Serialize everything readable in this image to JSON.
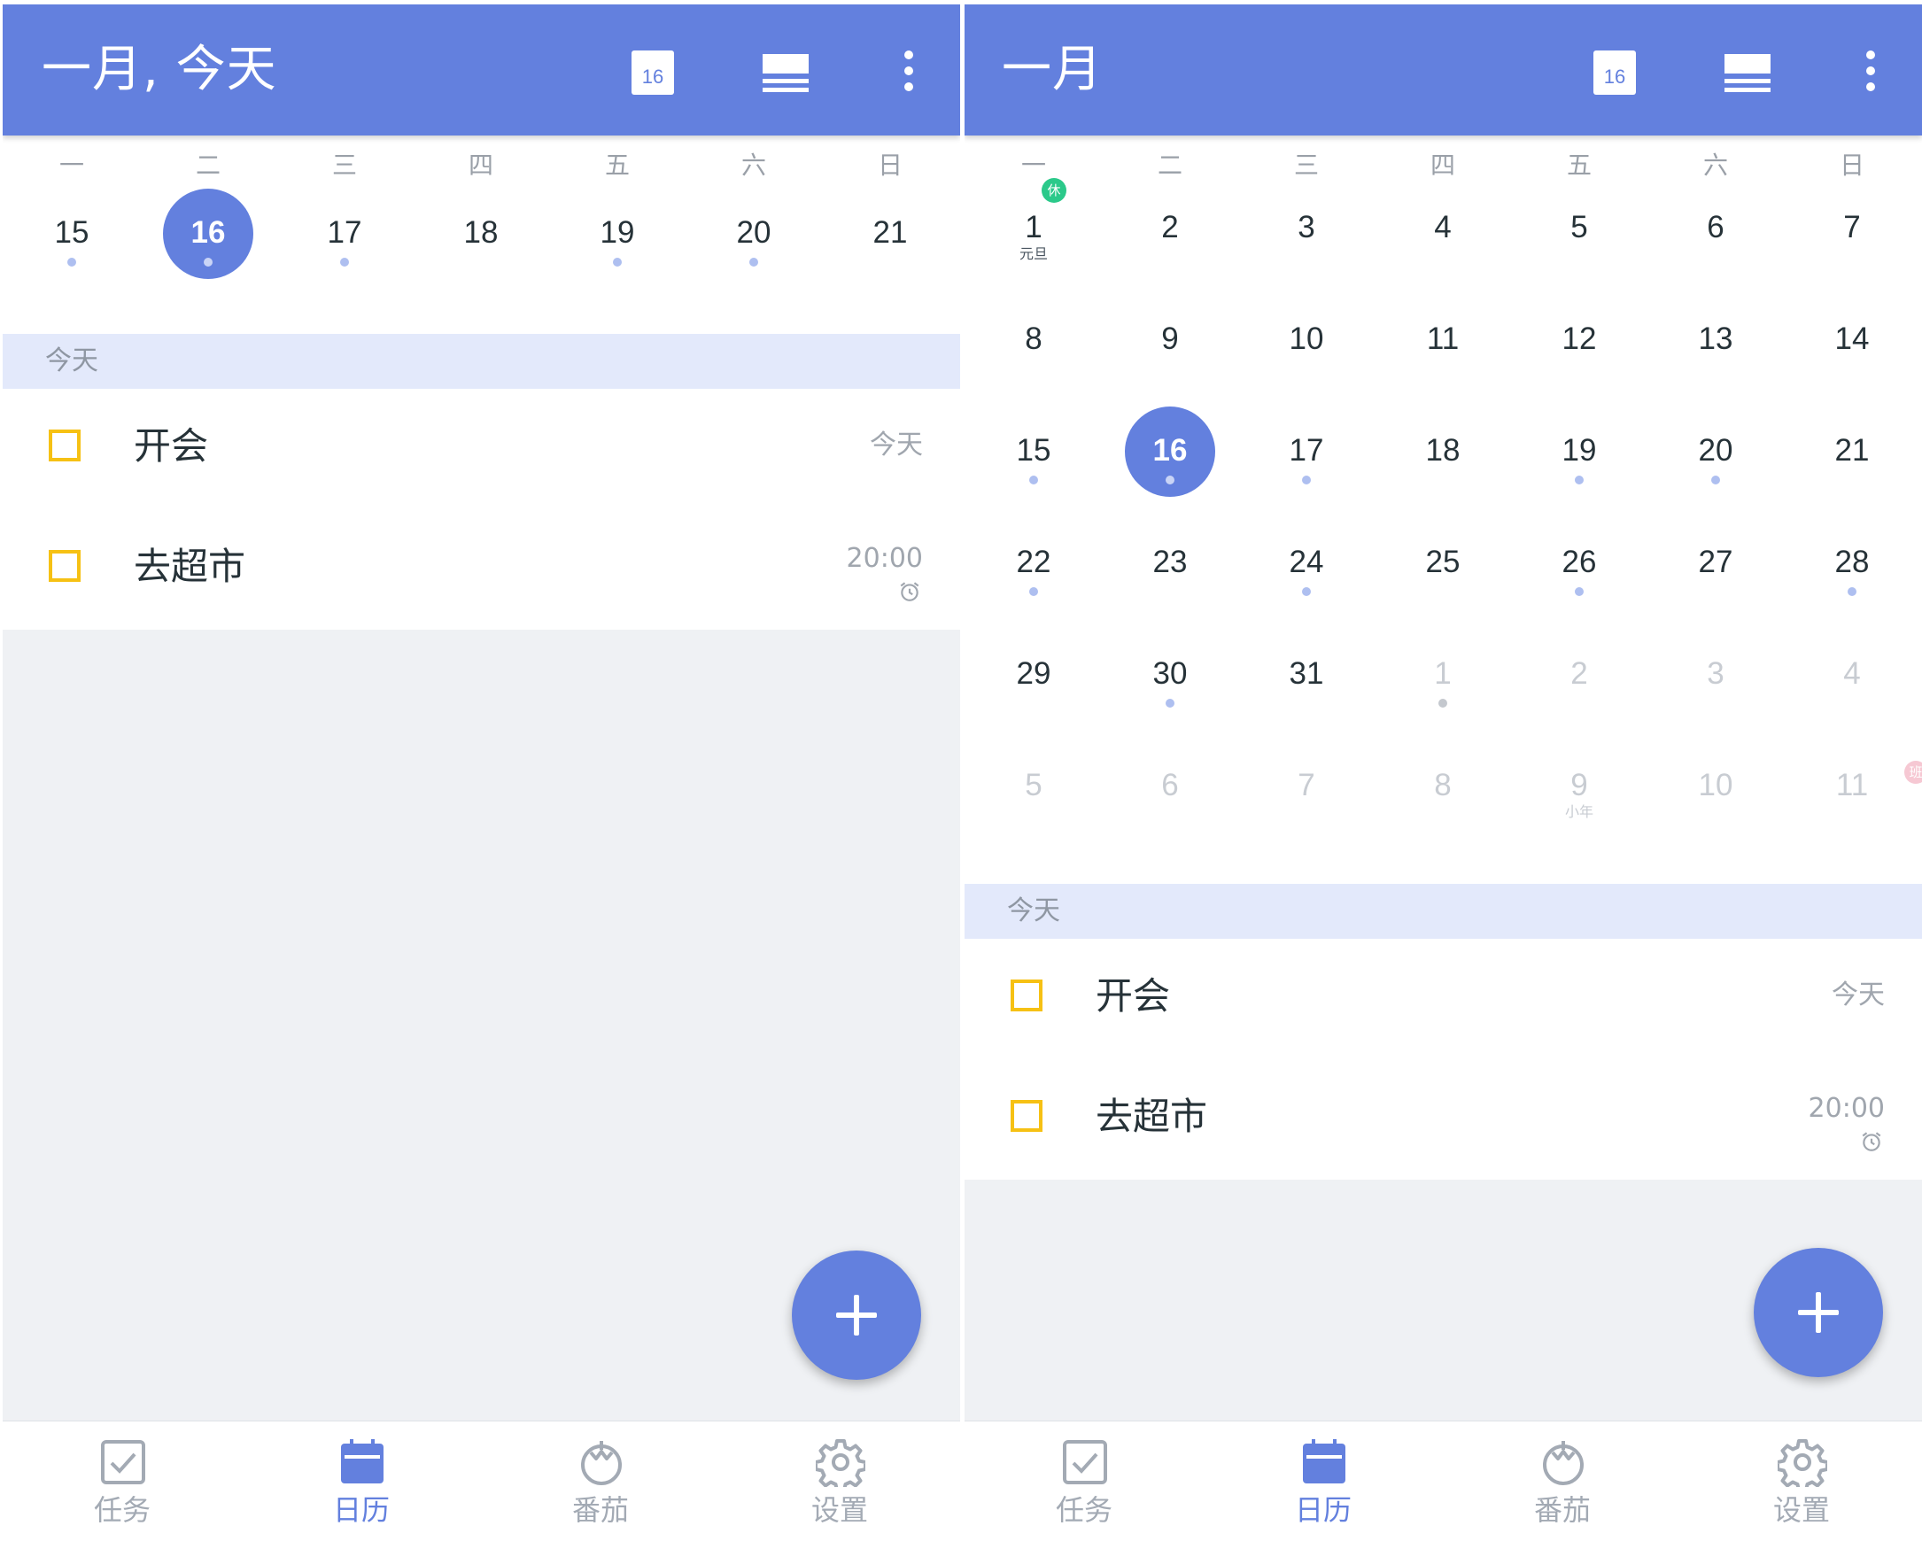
{
  "colors": {
    "primary": "#6380de",
    "checkbox": "#f6c114",
    "section_bg": "#e3e9fb",
    "event_dot": "#aebff0",
    "rest_badge": "#2bc98a",
    "work_badge": "#f6c8d3"
  },
  "week_view": {
    "title": "一月, 今天",
    "today_icon_day": "16",
    "icons": [
      "today-calendar-icon",
      "view-toggle-icon",
      "more-vert-icon"
    ],
    "weekdays": [
      "一",
      "二",
      "三",
      "四",
      "五",
      "六",
      "日"
    ],
    "days": [
      {
        "n": "15",
        "dot": true
      },
      {
        "n": "16",
        "dot": true,
        "selected": true
      },
      {
        "n": "17",
        "dot": true
      },
      {
        "n": "18"
      },
      {
        "n": "19",
        "dot": true
      },
      {
        "n": "20",
        "dot": true
      },
      {
        "n": "21"
      }
    ],
    "section_label": "今天",
    "tasks": [
      {
        "title": "开会",
        "meta": "今天"
      },
      {
        "title": "去超市",
        "meta": "20:00",
        "alarm": true
      }
    ]
  },
  "month_view": {
    "title": "一月",
    "today_icon_day": "16",
    "weekdays": [
      "一",
      "二",
      "三",
      "四",
      "五",
      "六",
      "日"
    ],
    "days": [
      {
        "n": "1",
        "sub": "元旦",
        "badge": "休",
        "badge_type": "rest"
      },
      {
        "n": "2"
      },
      {
        "n": "3"
      },
      {
        "n": "4"
      },
      {
        "n": "5"
      },
      {
        "n": "6"
      },
      {
        "n": "7"
      },
      {
        "n": "8"
      },
      {
        "n": "9"
      },
      {
        "n": "10"
      },
      {
        "n": "11"
      },
      {
        "n": "12"
      },
      {
        "n": "13"
      },
      {
        "n": "14"
      },
      {
        "n": "15",
        "dot": true
      },
      {
        "n": "16",
        "dot": true,
        "selected": true
      },
      {
        "n": "17",
        "dot": true
      },
      {
        "n": "18"
      },
      {
        "n": "19",
        "dot": true
      },
      {
        "n": "20",
        "dot": true
      },
      {
        "n": "21"
      },
      {
        "n": "22",
        "dot": true
      },
      {
        "n": "23"
      },
      {
        "n": "24",
        "dot": true
      },
      {
        "n": "25"
      },
      {
        "n": "26",
        "dot": true
      },
      {
        "n": "27"
      },
      {
        "n": "28",
        "dot": true
      },
      {
        "n": "29"
      },
      {
        "n": "30",
        "dot": true
      },
      {
        "n": "31"
      },
      {
        "n": "1",
        "other": true,
        "dot": true
      },
      {
        "n": "2",
        "other": true
      },
      {
        "n": "3",
        "other": true
      },
      {
        "n": "4",
        "other": true
      },
      {
        "n": "5",
        "other": true
      },
      {
        "n": "6",
        "other": true
      },
      {
        "n": "7",
        "other": true
      },
      {
        "n": "8",
        "other": true
      },
      {
        "n": "9",
        "other": true,
        "sub": "小年"
      },
      {
        "n": "10",
        "other": true
      },
      {
        "n": "11",
        "other": true,
        "badge": "班",
        "badge_type": "work"
      }
    ],
    "section_label": "今天",
    "tasks": [
      {
        "title": "开会",
        "meta": "今天"
      },
      {
        "title": "去超市",
        "meta": "20:00",
        "alarm": true
      }
    ]
  },
  "fab_icon": "plus-icon",
  "bottom_nav": [
    {
      "label": "任务",
      "icon": "task-check-icon"
    },
    {
      "label": "日历",
      "icon": "calendar-icon",
      "active": true
    },
    {
      "label": "番茄",
      "icon": "tomato-icon"
    },
    {
      "label": "设置",
      "icon": "settings-gear-icon"
    }
  ]
}
